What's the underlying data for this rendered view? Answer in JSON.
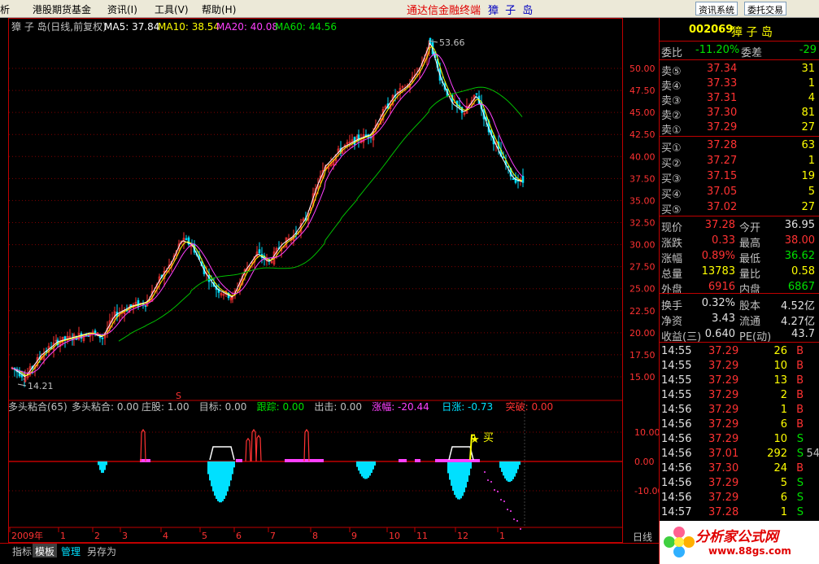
{
  "menu": {
    "items": [
      "析",
      "港股期货基金",
      "资讯(I)",
      "工具(V)",
      "帮助(H)"
    ],
    "brand": "通达信金融终端",
    "stock_name_title": "獐 子 岛",
    "btn_news": "资讯系统",
    "btn_trade": "委托交易"
  },
  "chart": {
    "title": "獐 子 岛(日线,前复权)",
    "ma5": "MA5: 37.84",
    "ma10": "MA10: 38.54",
    "ma20": "MA20: 40.08",
    "ma60": "MA60: 44.56",
    "high_label": "53.66",
    "low_label": "14.21",
    "price_ticks": [
      "50.00",
      "47.50",
      "45.00",
      "42.50",
      "40.00",
      "37.50",
      "35.00",
      "32.50",
      "30.00",
      "27.50",
      "25.00",
      "22.50",
      "20.00",
      "17.50",
      "15.00"
    ],
    "sub_title": "多头粘合(65)",
    "sub_items": [
      {
        "text": "多头粘合: 0.00",
        "color": "#c0c0c0"
      },
      {
        "text": "庄股: 1.00",
        "color": "#c0c0c0"
      },
      {
        "text": "目标: 0.00",
        "color": "#c0c0c0"
      },
      {
        "text": "跟踪: 0.00",
        "color": "#00e000"
      },
      {
        "text": "出击: 0.00",
        "color": "#c0c0c0"
      },
      {
        "text": "涨幅: -20.44",
        "color": "#ff40ff"
      },
      {
        "text": "日涨: -0.73",
        "color": "#00e0ff"
      },
      {
        "text": "突破: 0.00",
        "color": "#ff3232"
      }
    ],
    "sub_ticks": [
      "10.00",
      "0.00",
      "-10.00"
    ],
    "buy_label": "买",
    "s_marker": "S",
    "time_labels": [
      "2009年",
      "1",
      "2",
      "3",
      "4",
      "5",
      "6",
      "7",
      "8",
      "9",
      "10",
      "11",
      "12",
      "1"
    ],
    "period_label": "日线"
  },
  "panel": {
    "code": "002069",
    "name": "獐 子 岛",
    "weibi_label": "委比",
    "weibi_value": "-11.20%",
    "weicha_label": "委差",
    "weicha_value": "-29",
    "sells": [
      {
        "label": "卖⑤",
        "price": "37.34",
        "vol": "31"
      },
      {
        "label": "卖④",
        "price": "37.33",
        "vol": "1"
      },
      {
        "label": "卖③",
        "price": "37.31",
        "vol": "4"
      },
      {
        "label": "卖②",
        "price": "37.30",
        "vol": "81"
      },
      {
        "label": "卖①",
        "price": "37.29",
        "vol": "27"
      }
    ],
    "buys": [
      {
        "label": "买①",
        "price": "37.28",
        "vol": "63"
      },
      {
        "label": "买②",
        "price": "37.27",
        "vol": "1"
      },
      {
        "label": "买③",
        "price": "37.15",
        "vol": "19"
      },
      {
        "label": "买④",
        "price": "37.05",
        "vol": "5"
      },
      {
        "label": "买⑤",
        "price": "37.02",
        "vol": "27"
      }
    ],
    "quote": [
      {
        "l1": "现价",
        "v1": "37.28",
        "c1": "red",
        "l2": "今开",
        "v2": "36.95",
        "c2": "white"
      },
      {
        "l1": "涨跌",
        "v1": "0.33",
        "c1": "red",
        "l2": "最高",
        "v2": "38.00",
        "c2": "red"
      },
      {
        "l1": "涨幅",
        "v1": "0.89%",
        "c1": "red",
        "l2": "最低",
        "v2": "36.62",
        "c2": "green"
      },
      {
        "l1": "总量",
        "v1": "13783",
        "c1": "yellow",
        "l2": "量比",
        "v2": "0.58",
        "c2": "yellow"
      },
      {
        "l1": "外盘",
        "v1": "6916",
        "c1": "red",
        "l2": "内盘",
        "v2": "6867",
        "c2": "green"
      }
    ],
    "fund": [
      {
        "l1": "换手",
        "v1": "0.32%",
        "l2": "股本",
        "v2": "4.52亿"
      },
      {
        "l1": "净资",
        "v1": "3.43",
        "l2": "流通",
        "v2": "4.27亿"
      },
      {
        "l1": "收益(三)",
        "v1": "0.640",
        "l2": "PE(动)",
        "v2": "43.7"
      }
    ],
    "ticks": [
      {
        "time": "14:55",
        "price": "37.29",
        "vol": "26",
        "bs": "B"
      },
      {
        "time": "14:55",
        "price": "37.29",
        "vol": "10",
        "bs": "B"
      },
      {
        "time": "14:55",
        "price": "37.29",
        "vol": "13",
        "bs": "B"
      },
      {
        "time": "14:55",
        "price": "37.29",
        "vol": "2",
        "bs": "B"
      },
      {
        "time": "14:56",
        "price": "37.29",
        "vol": "1",
        "bs": "B"
      },
      {
        "time": "14:56",
        "price": "37.29",
        "vol": "6",
        "bs": "B"
      },
      {
        "time": "14:56",
        "price": "37.29",
        "vol": "10",
        "bs": "S"
      },
      {
        "time": "14:56",
        "price": "37.01",
        "vol": "292",
        "bs": "S",
        "extra": "54"
      },
      {
        "time": "14:56",
        "price": "37.30",
        "vol": "24",
        "bs": "B"
      },
      {
        "time": "14:56",
        "price": "37.29",
        "vol": "5",
        "bs": "S"
      },
      {
        "time": "14:56",
        "price": "37.29",
        "vol": "6",
        "bs": "S"
      },
      {
        "time": "14:57",
        "price": "37.28",
        "vol": "1",
        "bs": "S"
      }
    ]
  },
  "tabs": [
    "指标",
    "模板",
    "管理",
    "另存为"
  ],
  "watermark": {
    "text": "分析家公式网",
    "url": "www.88gs.com"
  },
  "colors": {
    "up": "#ff3232",
    "down": "#00e0ff",
    "ma5": "#ffffff",
    "ma10": "#ffff00",
    "ma20": "#ff40ff",
    "ma60": "#00c000",
    "grid": "#800000"
  }
}
